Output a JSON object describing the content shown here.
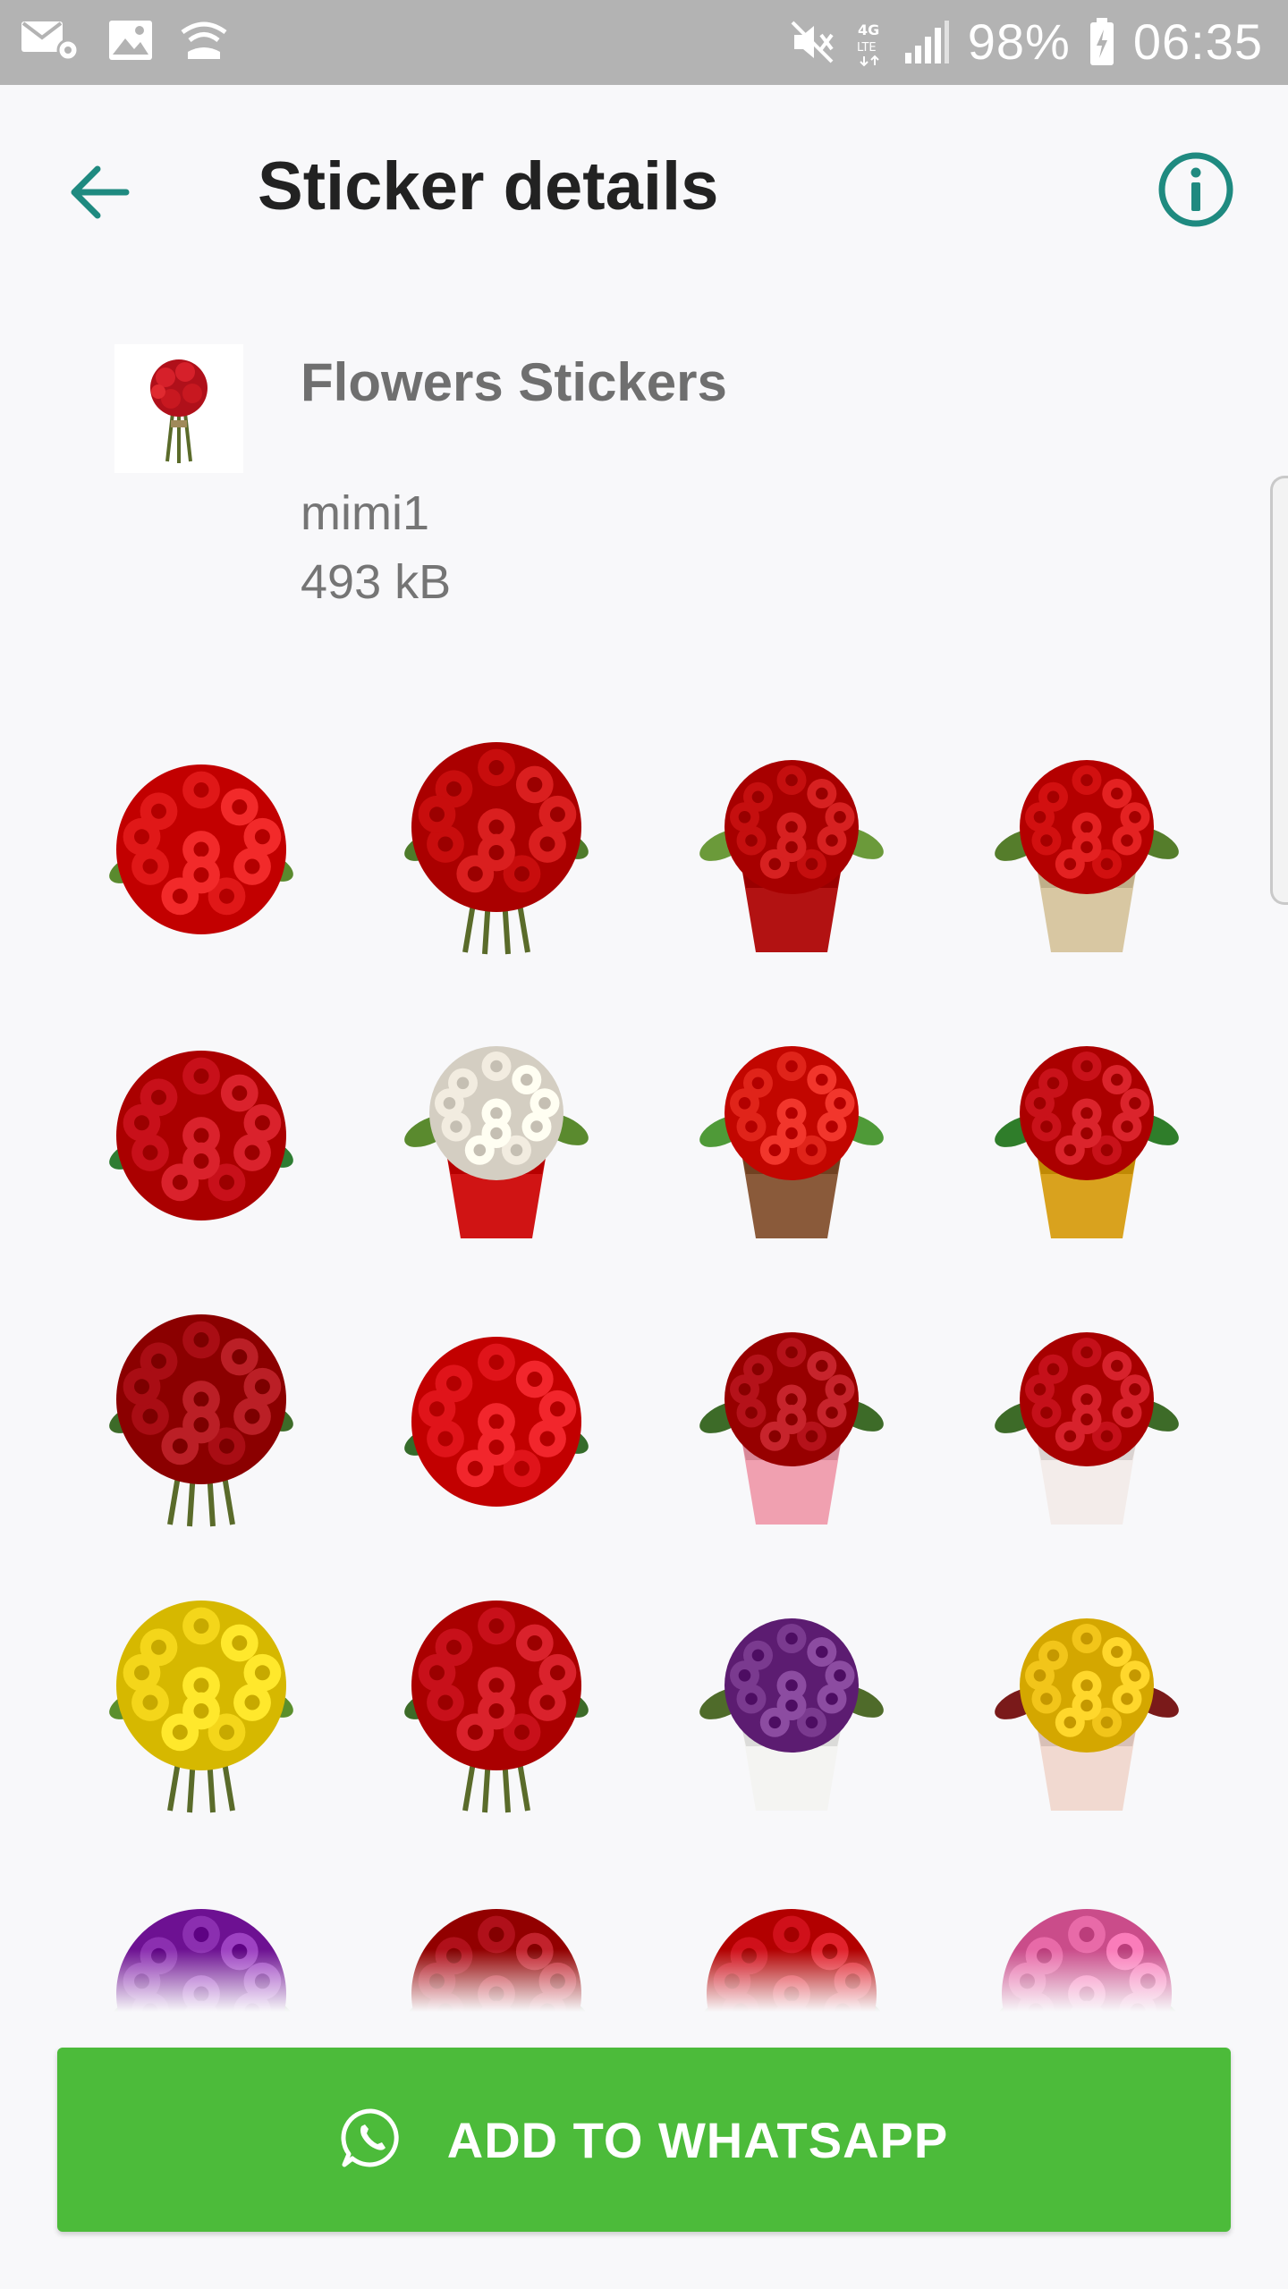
{
  "status_bar": {
    "battery": "98%",
    "time": "06:35",
    "icons": [
      "email-settings-icon",
      "image-icon",
      "wifi-calling-icon",
      "mute-icon",
      "4g-lte-icon",
      "signal-icon",
      "battery-charging-icon"
    ]
  },
  "app_bar": {
    "title": "Sticker details",
    "back_icon": "arrow-back-icon",
    "info_icon": "info-icon"
  },
  "pack": {
    "name": "Flowers Stickers",
    "publisher": "mimi1",
    "size": "493 kB"
  },
  "stickers": [
    {
      "name": "red-rose-ball",
      "flower": "#e01818",
      "leaf": "#5a8a2e",
      "base": "none"
    },
    {
      "name": "red-rose-bouquet",
      "flower": "#c80d0d",
      "leaf": "#4e7b2a",
      "base": "stems"
    },
    {
      "name": "roses-in-red-vase",
      "flower": "#c50f0f",
      "leaf": "#6b9a3a",
      "base": "#b21212"
    },
    {
      "name": "roses-in-glass-vase",
      "flower": "#d21010",
      "leaf": "#557d2b",
      "base": "#d8c7a2"
    },
    {
      "name": "three-red-roses",
      "flower": "#c8101a",
      "leaf": "#2e7d32",
      "base": "none"
    },
    {
      "name": "daisies-red-vase",
      "flower": "#f2ece0",
      "leaf": "#5a8a2e",
      "base": "#d01414"
    },
    {
      "name": "tulips-in-pot",
      "flower": "#e0241a",
      "leaf": "#4f9a38",
      "base": "#8a5a3a"
    },
    {
      "name": "christmas-roses",
      "flower": "#c9121a",
      "leaf": "#2f7d2a",
      "base": "#d9a21e"
    },
    {
      "name": "dark-red-bouquet",
      "flower": "#a90d14",
      "leaf": "#3d6b28",
      "base": "stems"
    },
    {
      "name": "two-roses-leaves",
      "flower": "#e0141a",
      "leaf": "#356b2a",
      "base": "none"
    },
    {
      "name": "rose-heart",
      "flower": "#b5121a",
      "leaf": "#3d6b28",
      "base": "#f0a0b0"
    },
    {
      "name": "roses-hat-box",
      "flower": "#c5101a",
      "leaf": "#3d6b28",
      "base": "#f3ecea"
    },
    {
      "name": "yellow-rose-bouquet",
      "flower": "#f4d61a",
      "leaf": "#5b8f2c",
      "base": "stems"
    },
    {
      "name": "red-white-bouquet",
      "flower": "#c8101a",
      "leaf": "#3d6b28",
      "base": "stems"
    },
    {
      "name": "purple-flowers-pot",
      "flower": "#7a3a8f",
      "leaf": "#4f6b2a",
      "base": "#f4f4f2"
    },
    {
      "name": "heart-box-yellow",
      "flower": "#f2c51a",
      "leaf": "#7a1a1a",
      "base": "#f1d9d0"
    },
    {
      "name": "purple-calla-lilies",
      "flower": "#8b2fb0",
      "leaf": "#3d7b2a",
      "base": "none"
    },
    {
      "name": "dark-red-roses",
      "flower": "#b0101a",
      "leaf": "#3d6b28",
      "base": "none"
    },
    {
      "name": "red-white-roses",
      "flower": "#d0101a",
      "leaf": "#3d6b28",
      "base": "none"
    },
    {
      "name": "pink-mixed-bouquet",
      "flower": "#e86aa8",
      "leaf": "#5a8a2e",
      "base": "none"
    }
  ],
  "add_button": {
    "label": "ADD TO WHATSAPP",
    "icon": "whatsapp-icon"
  },
  "colors": {
    "accent": "#1f8a80",
    "button": "#4cbb3a",
    "status_bar": "#b3b3b3"
  }
}
